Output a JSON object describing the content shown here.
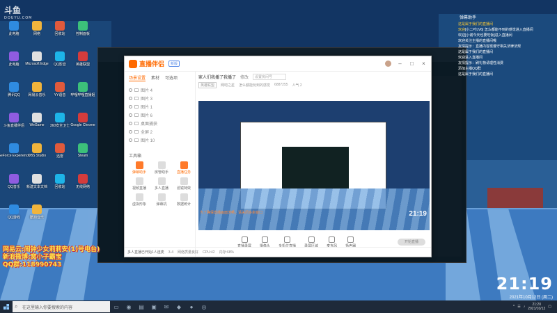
{
  "watermark": {
    "brand": "斗鱼",
    "sub": "DOUYU.COM"
  },
  "desktop_icons": [
    "此电脑",
    "网络",
    "回收站",
    "控制面板",
    "此电脑",
    "Microsoft Edge",
    "QQ影音",
    "英雄联盟",
    "腾讯QQ",
    "网易云音乐",
    "YY语音",
    "哔哩哔哩直播姬",
    "斗鱼直播伴侣",
    "WeGame",
    "360安全卫士",
    "Google Chrome",
    "GeForce Experience",
    "OBS Studio",
    "迅雷",
    "Steam",
    "QQ音乐",
    "新建文本文档",
    "回收站",
    "无线网络",
    "QQ游戏",
    "酷狗音乐"
  ],
  "app": {
    "brand_name": "直播伴侣",
    "version": "新版",
    "side_tabs": [
      "场景设置",
      "素材",
      "可选项"
    ],
    "scenes": [
      "图片 4",
      "图片 3",
      "图片 1",
      "图片 6",
      "桌面捕获",
      "全屏 2",
      "图片 10"
    ],
    "tools_title": "工具箱",
    "tools": [
      {
        "label": "弹幕助手",
        "hl": true
      },
      {
        "label": "房管助手",
        "hl": false
      },
      {
        "label": "直播任务",
        "hl": true
      },
      {
        "label": "视频直播",
        "hl": false
      },
      {
        "label": "多人直播",
        "hl": false
      },
      {
        "label": "滤镜特效",
        "hl": false
      },
      {
        "label": "虚拟形象",
        "hl": false
      },
      {
        "label": "弹幕机",
        "hl": false
      },
      {
        "label": "数据统计",
        "hl": false
      }
    ],
    "live_title": "家人们我播了我播了",
    "edit_label": "修改",
    "search_placeholder": "设置房间号",
    "sub_info": [
      "英雄联盟",
      "网吧之星",
      "怎么都能玩到的感觉",
      "6887255",
      "人气 2"
    ],
    "preview_clock": "21:19",
    "preview_note": "为了确保直播画面流畅，请关闭多余窗口",
    "controls": [
      "直播录屏",
      "摄像头",
      "多机位直播",
      "录屏区域",
      "麦克风",
      "扬声器"
    ],
    "start_label": "开始直播",
    "footer": [
      "多人直播已开始1人连麦",
      "3-4",
      "网络质量良好",
      "CPU:42",
      "内存:68%"
    ]
  },
  "chat": {
    "title": "弹幕助手",
    "lines": [
      {
        "user": "这是属于我们的直播间",
        "msg": ""
      },
      {
        "user": "欢迎",
        "msg": "[小二叶LV6] 怎么都能不到的感觉进入直播间"
      },
      {
        "user": "",
        "msg": "欢迎[小谢今天也要吃饭]进入直播间"
      },
      {
        "user": "",
        "msg": "欢迎关注主播的直播间哦"
      },
      {
        "user": "",
        "msg": "友情提示：直播内容需遵守相关法律法规"
      },
      {
        "user": "",
        "msg": "这是属于我们的直播间"
      },
      {
        "user": "",
        "msg": "欢迎进入直播间"
      },
      {
        "user": "",
        "msg": "友情提示：刷礼物请理性消费"
      },
      {
        "user": "",
        "msg": "添加主播QQ群"
      },
      {
        "user": "",
        "msg": "这是属于我们的直播间"
      }
    ]
  },
  "overlay": {
    "line1": "网易云:闹钟少女莉莉安(1)号电台)",
    "line2": "新浪微博:窝小子霸宝",
    "line3": "QQ群:118990743"
  },
  "clock": {
    "time": "21:19",
    "date": "2021年10月12日 (周二)"
  },
  "taskbar": {
    "search_placeholder": "在这里输入你要搜索的内容",
    "tray_time": "21:20",
    "tray_date": "2021/10/12"
  }
}
